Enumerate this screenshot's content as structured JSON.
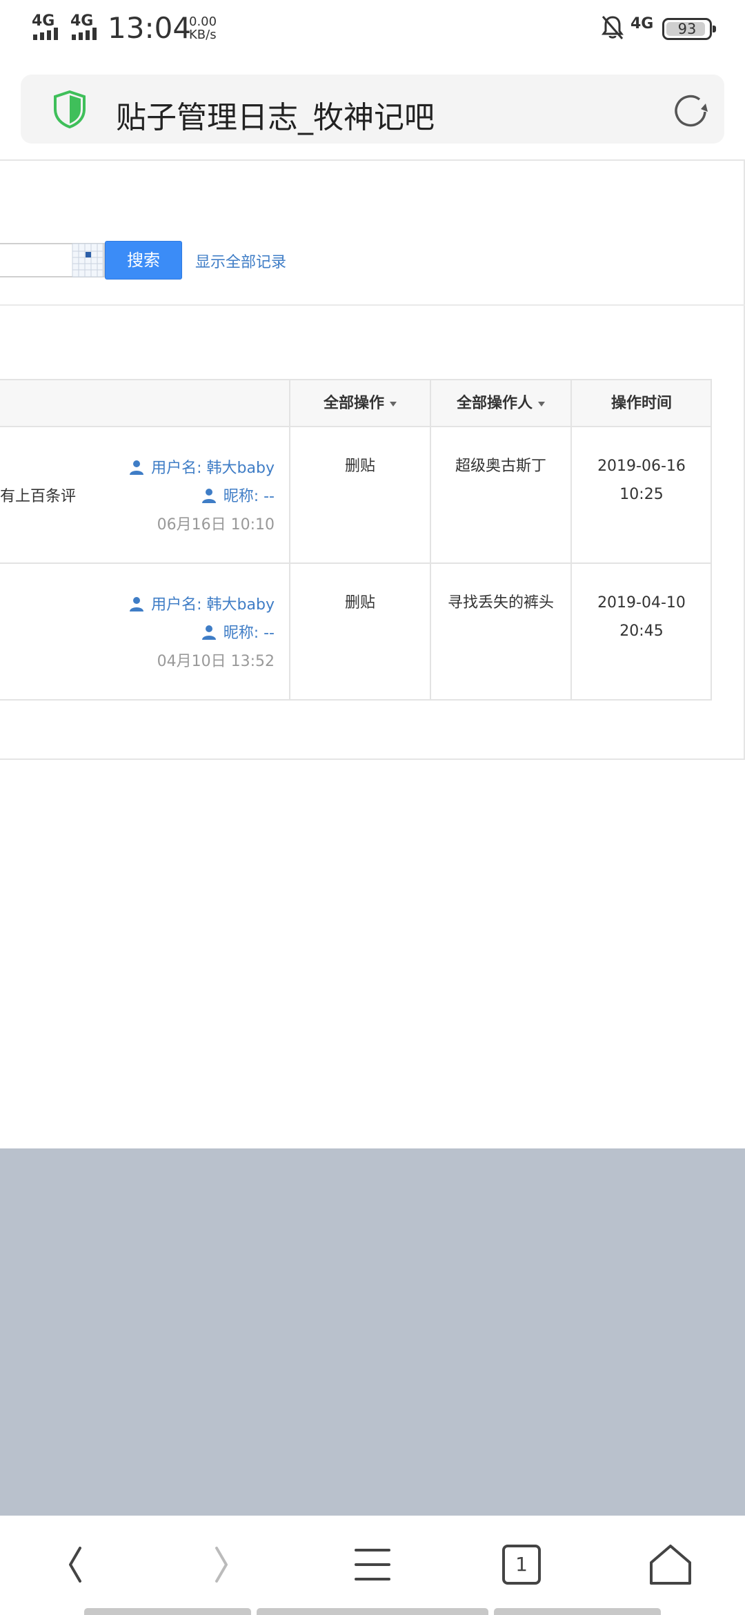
{
  "status_bar": {
    "network_1": "4G",
    "network_2": "4G",
    "time": "13:04",
    "speed_value": "0.00",
    "speed_unit": "KB/s",
    "network_right": "4G",
    "battery": "93"
  },
  "url_bar": {
    "title": "贴子管理日志_牧神记吧"
  },
  "search": {
    "button_label": "搜索",
    "show_all_label": "显示全部记录"
  },
  "table": {
    "columns": {
      "action": "全部操作",
      "operator": "全部操作人",
      "time": "操作时间"
    },
    "rows": [
      {
        "snippet": "有上百条评",
        "username": "用户名: 韩大baby",
        "nickname": "昵称: --",
        "post_date": "06月16日 10:10",
        "action": "删贴",
        "operator": "超级奥古斯丁",
        "date": "2019-06-16",
        "clock": "10:25"
      },
      {
        "snippet": "",
        "username": "用户名: 韩大baby",
        "nickname": "昵称: --",
        "post_date": "04月10日 13:52",
        "action": "删贴",
        "operator": "寻找丢失的裤头",
        "date": "2019-04-10",
        "clock": "20:45"
      }
    ]
  },
  "bottom_nav": {
    "tabs_count": "1"
  },
  "colors": {
    "accent": "#3b8cf7",
    "link": "#3f7dc6",
    "grey_area": "#b9c1cc"
  }
}
